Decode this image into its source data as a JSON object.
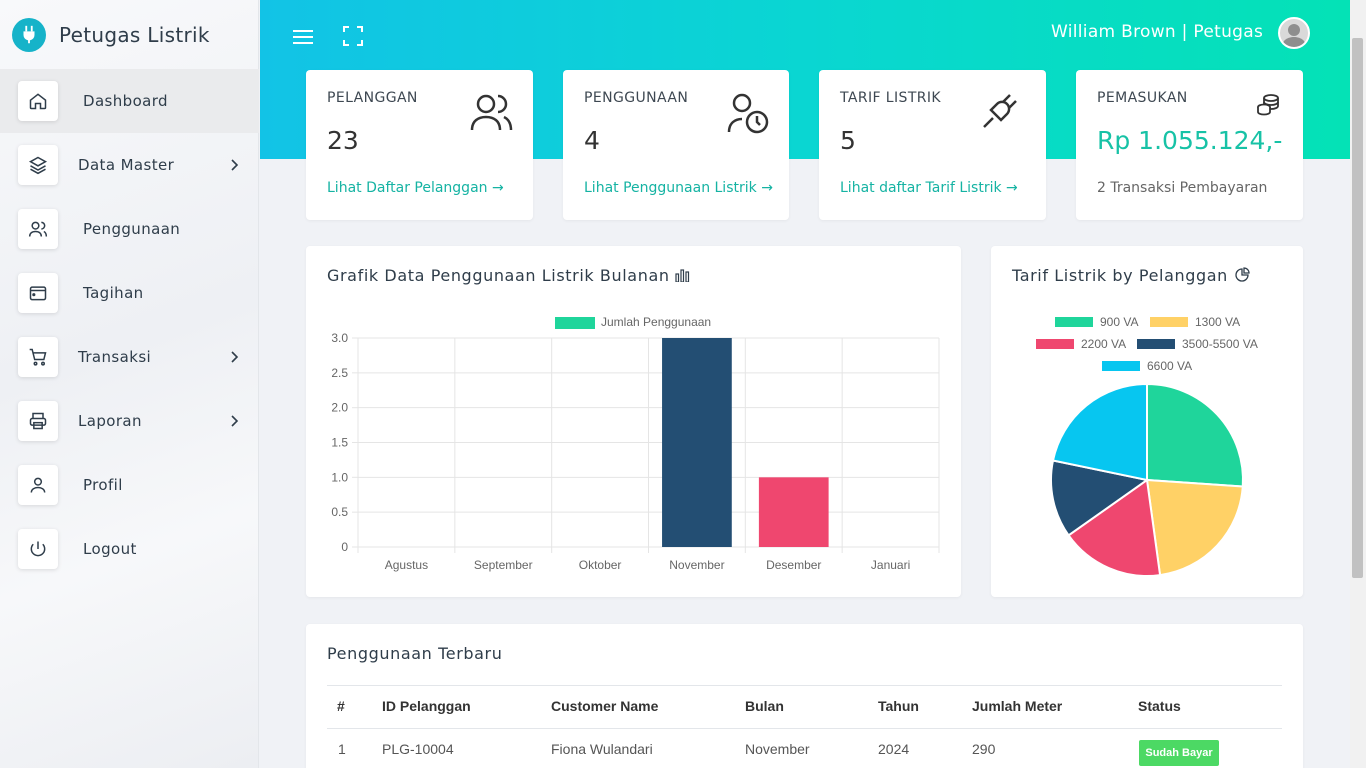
{
  "brand": {
    "title": "Petugas Listrik"
  },
  "sidebar": {
    "items": [
      {
        "label": "Dashboard",
        "icon": "home-icon"
      },
      {
        "label": "Data Master",
        "icon": "layers-icon"
      },
      {
        "label": "Penggunaan",
        "icon": "users-icon"
      },
      {
        "label": "Tagihan",
        "icon": "wallet-icon"
      },
      {
        "label": "Transaksi",
        "icon": "cart-icon"
      },
      {
        "label": "Laporan",
        "icon": "printer-icon"
      },
      {
        "label": "Profil",
        "icon": "user-icon"
      },
      {
        "label": "Logout",
        "icon": "power-icon"
      }
    ]
  },
  "topbar": {
    "user": "William Brown | Petugas"
  },
  "stats": [
    {
      "title": "PELANGGAN",
      "value": "23",
      "link": "Lihat Daftar Pelanggan →"
    },
    {
      "title": "PENGGUNAAN",
      "value": "4",
      "link": "Lihat Penggunaan Listrik →"
    },
    {
      "title": "TARIF LISTRIK",
      "value": "5",
      "link": "Lihat daftar Tarif Listrik →"
    },
    {
      "title": "PEMASUKAN",
      "value": "Rp 1.055.124,-",
      "sub": "2 Transaksi Pembayaran"
    }
  ],
  "bar_card": {
    "title": "Grafik Data Penggunaan Listrik Bulanan"
  },
  "pie_card": {
    "title": "Tarif Listrik by Pelanggan"
  },
  "chart_data": [
    {
      "type": "bar",
      "title": "Grafik Data Penggunaan Listrik Bulanan",
      "categories": [
        "Agustus",
        "September",
        "Oktober",
        "November",
        "Desember",
        "Januari"
      ],
      "series": [
        {
          "name": "Jumlah Penggunaan",
          "values": [
            0,
            0,
            0,
            3,
            1,
            0
          ]
        }
      ],
      "bar_colors": [
        "#234e73",
        "#234e73",
        "#234e73",
        "#234e73",
        "#ef476f",
        "#234e73"
      ],
      "legend_color": "#1fd59b",
      "ylim": [
        0,
        3
      ],
      "yticks": [
        "0",
        "0.5",
        "1.0",
        "1.5",
        "2.0",
        "2.5",
        "3.0"
      ],
      "yvalues": [
        0,
        0.5,
        1,
        1.5,
        2,
        2.5,
        3
      ],
      "grid": true,
      "legend": "top-center"
    },
    {
      "type": "pie",
      "title": "Tarif Listrik by Pelanggan",
      "labels": [
        "900 VA",
        "1300 VA",
        "2200 VA",
        "3500-5500 VA",
        "6600 VA"
      ],
      "values": [
        6,
        5,
        4,
        3,
        5
      ],
      "colors": [
        "#1fd59b",
        "#ffd166",
        "#ef476f",
        "#234e73",
        "#07c6f0"
      ],
      "legend": "top"
    }
  ],
  "table": {
    "title": "Penggunaan Terbaru",
    "headers": [
      "#",
      "ID Pelanggan",
      "Customer Name",
      "Bulan",
      "Tahun",
      "Jumlah Meter",
      "Status"
    ],
    "rows": [
      [
        "1",
        "PLG-10004",
        "Fiona Wulandari",
        "November",
        "2024",
        "290",
        "Sudah Bayar"
      ]
    ]
  }
}
